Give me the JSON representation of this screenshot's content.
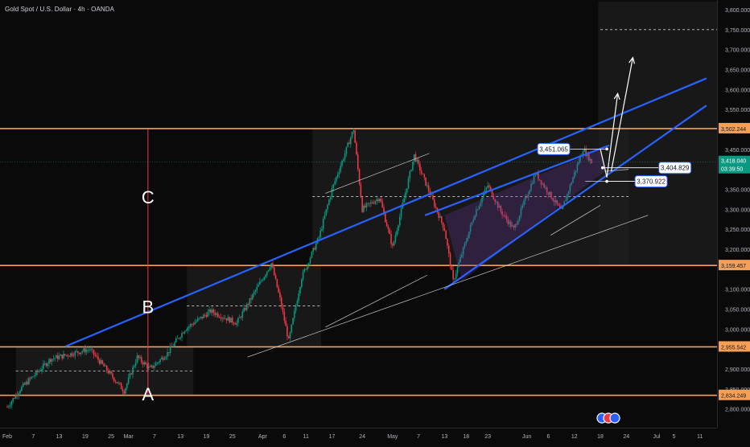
{
  "header": {
    "title": "Gold Spot / U.S. Dollar · 4h · OANDA"
  },
  "colors": {
    "background": "#0a0a0a",
    "candle_up": "#089981",
    "candle_down": "#f23645",
    "level_line": "#f5a056",
    "trend_line": "#2962ff",
    "channel_line": "#d1d4dc",
    "vertical_marker": "#f23645",
    "current_price_label": "#089981",
    "wedge_fill": "#6a3aa0"
  },
  "price_scale": {
    "ticks": [
      "3,800.000",
      "3,750.000",
      "3,700.000",
      "3,650.000",
      "3,600.000",
      "3,550.000",
      "3,450.000",
      "3,350.000",
      "3,300.000",
      "3,250.000",
      "3,200.000",
      "3,100.000",
      "3,050.000",
      "3,000.000",
      "2,950.000",
      "2,900.000",
      "2,850.000",
      "2,800.000"
    ],
    "highlight_labels": [
      {
        "text": "3,502.244",
        "kind": "level"
      },
      {
        "text": "3,159.457",
        "kind": "level"
      },
      {
        "text": "2,955.542",
        "kind": "level"
      },
      {
        "text": "2,834.249",
        "kind": "level"
      }
    ],
    "current_price": "3,418.040",
    "countdown": "03:39:50"
  },
  "time_scale": {
    "labels": [
      "Feb",
      "7",
      "13",
      "19",
      "25",
      "Mar",
      "7",
      "13",
      "19",
      "25",
      "Apr",
      "6",
      "11",
      "17",
      "24",
      "May",
      "7",
      "13",
      "18",
      "23",
      "Jun",
      "6",
      "12",
      "18",
      "24",
      "Jul",
      "5",
      "11"
    ]
  },
  "annotations": {
    "letters": [
      "C",
      "B",
      "A"
    ],
    "price_labels": [
      "3,451.065",
      "3,404.829",
      "3,370.922"
    ]
  },
  "chart_data": {
    "type": "candlestick",
    "symbol": "Gold Spot / U.S. Dollar",
    "interval": "4h",
    "source": "OANDA",
    "ylim": [
      2780,
      3820
    ],
    "horizontal_levels": [
      3502.244,
      3159.457,
      2955.542,
      2834.249
    ],
    "current_price": 3418.04,
    "swing_path": [
      {
        "date": "Feb 1",
        "price": 2805
      },
      {
        "date": "Feb 4",
        "price": 2850
      },
      {
        "date": "Feb 11",
        "price": 2925
      },
      {
        "date": "Feb 20",
        "price": 2950
      },
      {
        "date": "Feb 28",
        "price": 2845
      },
      {
        "date": "Mar 3",
        "price": 2930
      },
      {
        "date": "Mar 6",
        "price": 2900
      },
      {
        "date": "Mar 10",
        "price": 2940
      },
      {
        "date": "Mar 14",
        "price": 3000
      },
      {
        "date": "Mar 20",
        "price": 3045
      },
      {
        "date": "Mar 26",
        "price": 3015
      },
      {
        "date": "Apr 3",
        "price": 3165
      },
      {
        "date": "Apr 5",
        "price": 3075
      },
      {
        "date": "Apr 7",
        "price": 2970
      },
      {
        "date": "Apr 10",
        "price": 3130
      },
      {
        "date": "Apr 14",
        "price": 3230
      },
      {
        "date": "Apr 17",
        "price": 3350
      },
      {
        "date": "Apr 22",
        "price": 3500
      },
      {
        "date": "Apr 24",
        "price": 3300
      },
      {
        "date": "Apr 28",
        "price": 3330
      },
      {
        "date": "May 1",
        "price": 3205
      },
      {
        "date": "May 6",
        "price": 3435
      },
      {
        "date": "May 10",
        "price": 3330
      },
      {
        "date": "May 13",
        "price": 3250
      },
      {
        "date": "May 15",
        "price": 3120
      },
      {
        "date": "May 20",
        "price": 3290
      },
      {
        "date": "May 23",
        "price": 3360
      },
      {
        "date": "May 26",
        "price": 3295
      },
      {
        "date": "May 29",
        "price": 3250
      },
      {
        "date": "Jun 3",
        "price": 3390
      },
      {
        "date": "Jun 9",
        "price": 3295
      },
      {
        "date": "Jun 12",
        "price": 3390
      },
      {
        "date": "Jun 14",
        "price": 3451
      },
      {
        "date": "Jun 16",
        "price": 3418
      }
    ],
    "legend": "none",
    "grid": false
  }
}
